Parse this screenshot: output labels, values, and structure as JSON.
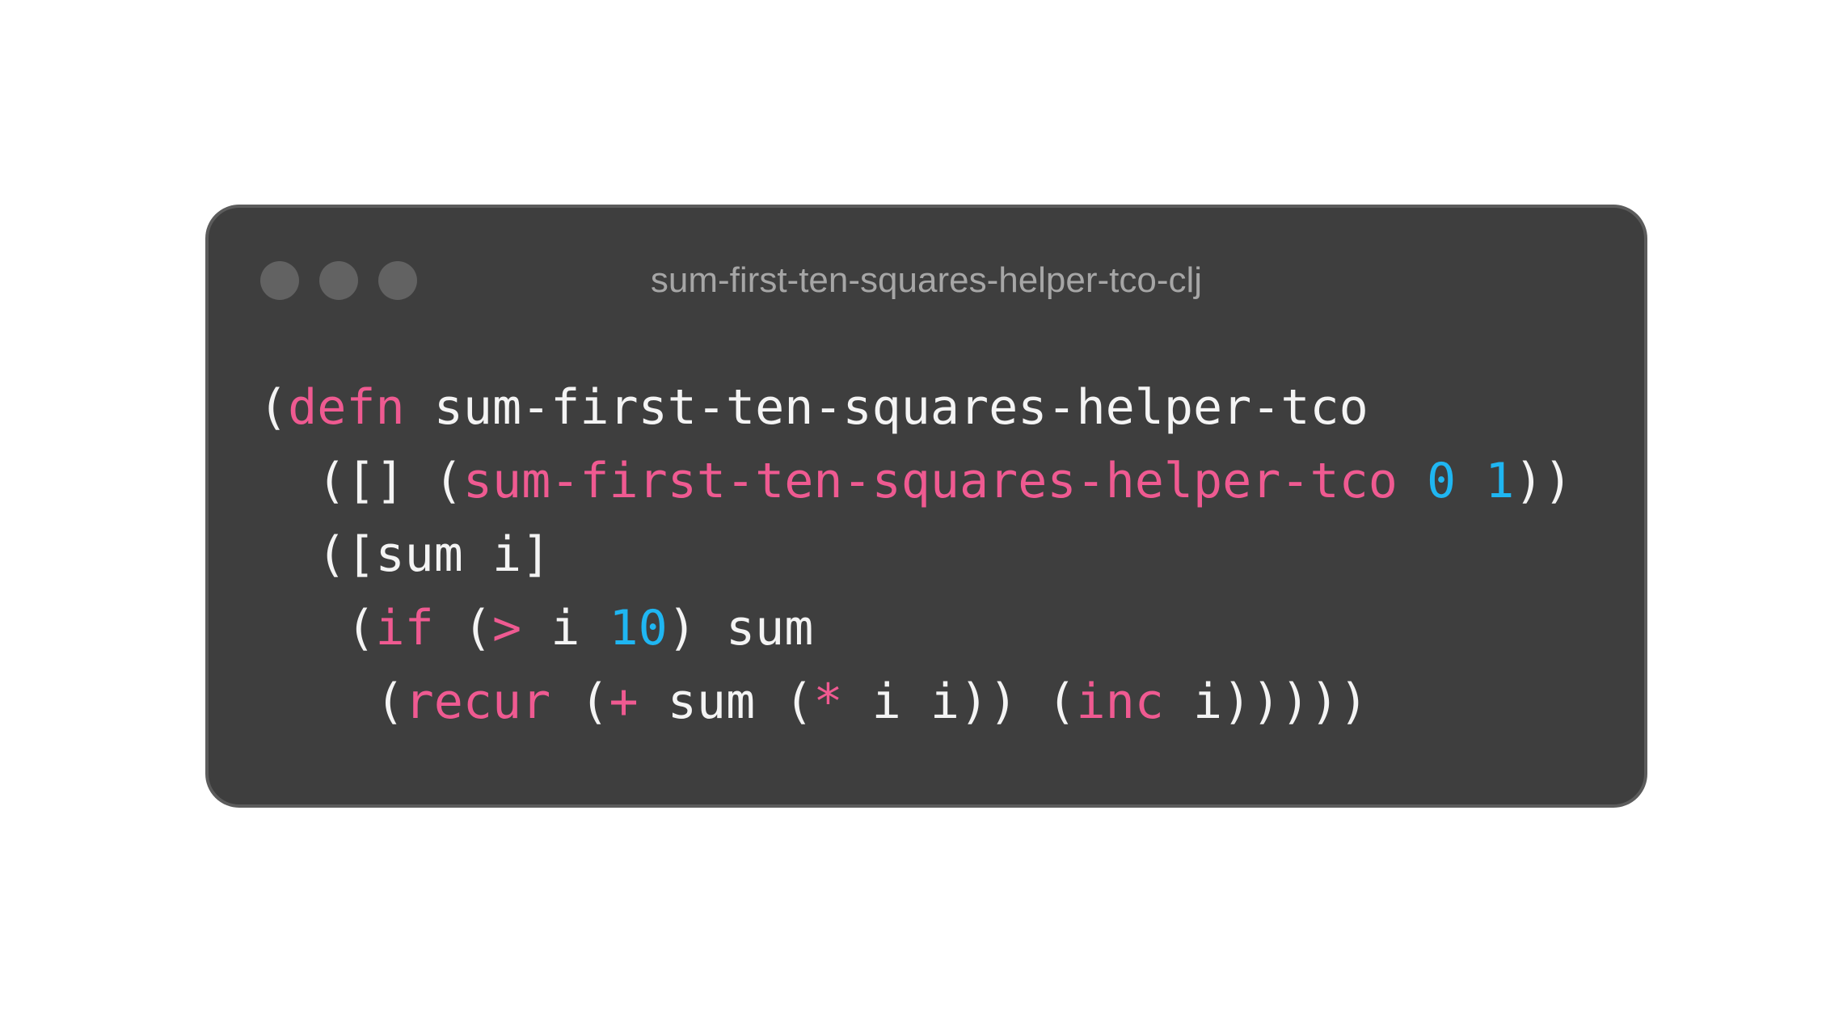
{
  "window": {
    "title": "sum-first-ten-squares-helper-tco-clj"
  },
  "colors": {
    "background": "#ffffff",
    "window_bg": "#3e3e3e",
    "window_border": "#5c5c5c",
    "dot": "#626262",
    "title_text": "#a6a6a6",
    "plain": "#f4f4f4",
    "keyword": "#ef5a91",
    "number": "#1fb6f2"
  },
  "code": {
    "lines": [
      [
        {
          "t": "plain",
          "v": "("
        },
        {
          "t": "kw",
          "v": "defn"
        },
        {
          "t": "plain",
          "v": " sum-first-ten-squares-helper-tco"
        }
      ],
      [
        {
          "t": "plain",
          "v": "  ([] ("
        },
        {
          "t": "kw",
          "v": "sum-first-ten-squares-helper-tco"
        },
        {
          "t": "plain",
          "v": " "
        },
        {
          "t": "num",
          "v": "0"
        },
        {
          "t": "plain",
          "v": " "
        },
        {
          "t": "num",
          "v": "1"
        },
        {
          "t": "plain",
          "v": "))"
        }
      ],
      [
        {
          "t": "plain",
          "v": "  ([sum i]"
        }
      ],
      [
        {
          "t": "plain",
          "v": "   ("
        },
        {
          "t": "kw",
          "v": "if"
        },
        {
          "t": "plain",
          "v": " ("
        },
        {
          "t": "kw",
          "v": ">"
        },
        {
          "t": "plain",
          "v": " i "
        },
        {
          "t": "num",
          "v": "10"
        },
        {
          "t": "plain",
          "v": ") sum"
        }
      ],
      [
        {
          "t": "plain",
          "v": "    ("
        },
        {
          "t": "kw",
          "v": "recur"
        },
        {
          "t": "plain",
          "v": " ("
        },
        {
          "t": "kw",
          "v": "+"
        },
        {
          "t": "plain",
          "v": " sum ("
        },
        {
          "t": "kw",
          "v": "*"
        },
        {
          "t": "plain",
          "v": " i i)) ("
        },
        {
          "t": "kw",
          "v": "inc"
        },
        {
          "t": "plain",
          "v": " i)))))"
        }
      ]
    ]
  }
}
